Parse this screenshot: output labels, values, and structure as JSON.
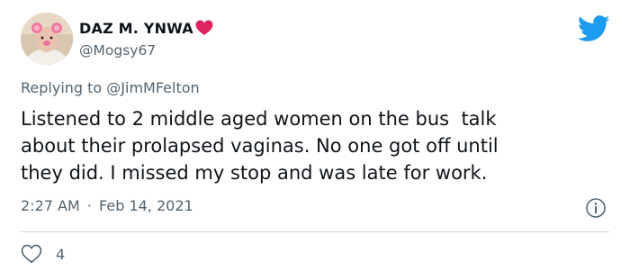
{
  "author": {
    "display_name": "DAZ M. YNWA",
    "handle": "@Mogsy67",
    "name_emoji": "red-heart-icon",
    "avatar": "avatar-photo"
  },
  "platform_icon": "twitter-bird-icon",
  "reply": {
    "prefix": "Replying to ",
    "to_handle": "@JimMFelton"
  },
  "tweet": {
    "text_lines": [
      "Listened to 2 middle aged women on the bus  talk",
      "about their prolapsed vaginas. No one got off until",
      "they did. I missed my stop and was late for work."
    ],
    "time": "2:27 AM",
    "separator": "·",
    "date": "Feb 14, 2021"
  },
  "info_icon": "info-icon",
  "engagement": {
    "like_icon": "heart-outline-icon",
    "likes": "4"
  },
  "colors": {
    "text": "#0f1419",
    "secondary": "#536471",
    "brand_blue": "#1d9bf0",
    "heart_red": "#e0245e",
    "divider": "#cfd9de"
  }
}
